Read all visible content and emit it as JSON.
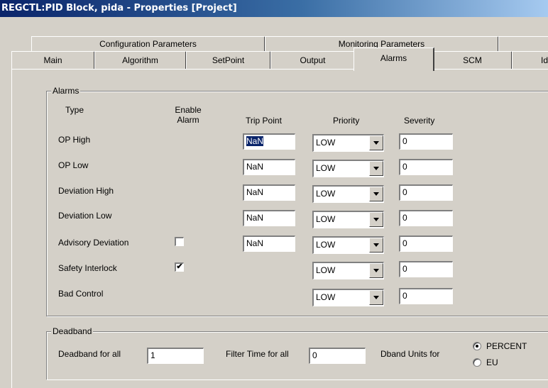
{
  "window": {
    "title": "REGCTL:PID Block, pida - Properties [Project]"
  },
  "tabs": {
    "back_row": [
      "Configuration Parameters",
      "Monitoring Parameters"
    ],
    "front_row": [
      "Main",
      "Algorithm",
      "SetPoint",
      "Output",
      "Alarms",
      "SCM",
      "Ide"
    ],
    "active": "Alarms"
  },
  "alarms": {
    "group_label": "Alarms",
    "headers": {
      "type": "Type",
      "enable_line1": "Enable",
      "enable_line2": "Alarm",
      "trip_point": "Trip Point",
      "priority": "Priority",
      "severity": "Severity"
    },
    "rows": [
      {
        "type": "OP High",
        "trip_point": "NaN",
        "priority": "LOW",
        "severity": "0"
      },
      {
        "type": "OP Low",
        "trip_point": "NaN",
        "priority": "LOW",
        "severity": "0"
      },
      {
        "type": "Deviation High",
        "trip_point": "NaN",
        "priority": "LOW",
        "severity": "0"
      },
      {
        "type": "Deviation Low",
        "trip_point": "NaN",
        "priority": "LOW",
        "severity": "0"
      },
      {
        "type": "Advisory Deviation",
        "enable": false,
        "trip_point": "NaN",
        "priority": "LOW",
        "severity": "0"
      },
      {
        "type": "Safety Interlock",
        "enable": true,
        "priority": "LOW",
        "severity": "0"
      },
      {
        "type": "Bad Control",
        "priority": "LOW",
        "severity": "0"
      }
    ],
    "checkmark": "✔"
  },
  "deadband": {
    "group_label": "Deadband",
    "deadband_label": "Deadband for all",
    "deadband_value": "1",
    "filter_label": "Filter Time for all",
    "filter_value": "0",
    "units_label": "Dband Units for",
    "options": [
      "PERCENT",
      "EU"
    ],
    "selected": "PERCENT"
  }
}
